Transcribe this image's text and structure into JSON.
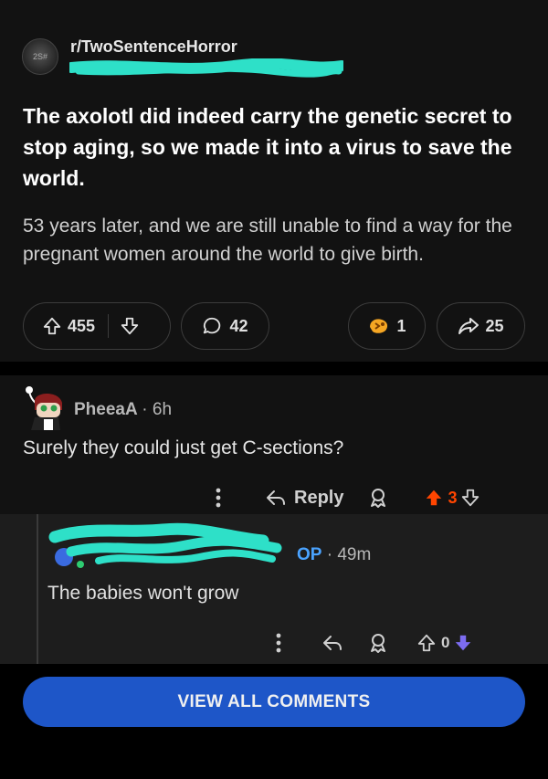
{
  "post": {
    "subreddit": "r/TwoSentenceHorror",
    "subreddit_icon_text": "2S#",
    "title": "The axolotl did indeed carry the genetic secret to stop aging, so we made it into a virus to save the world.",
    "body": "53 years later, and we are still unable to find a way for the pregnant women around the world to give birth.",
    "upvotes": "455",
    "comments": "42",
    "awards": "1",
    "shares": "25"
  },
  "comment1": {
    "author": "PheeaA",
    "time": "6h",
    "text": "Surely they could just get C-sections?",
    "reply_label": "Reply",
    "score": "3"
  },
  "comment2": {
    "op_badge": "OP",
    "time": "49m",
    "text": "The babies won't grow",
    "score": "0"
  },
  "view_all_label": "VIEW ALL COMMENTS",
  "colors": {
    "upvote_active": "#ff4500",
    "downvote_active": "#7c6cf0",
    "op_blue": "#4aa3ff",
    "button_blue": "#1e56c8",
    "scribble": "#2ee0c8"
  }
}
